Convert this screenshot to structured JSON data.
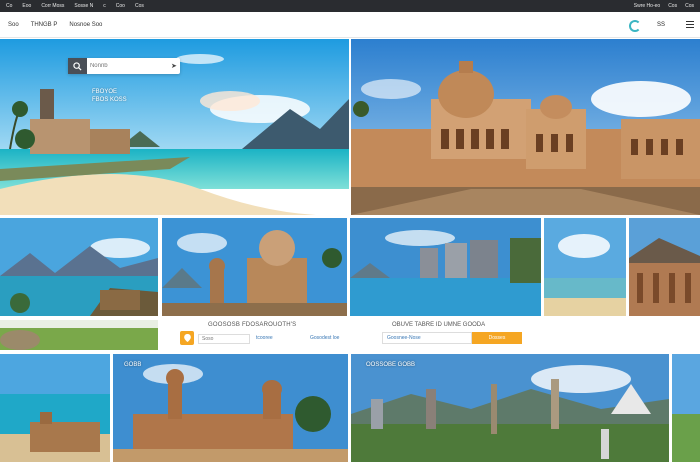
{
  "topbar": {
    "items": [
      "Co",
      "Eoo",
      "Corr Moss",
      "Sosse N",
      "c",
      "Coo",
      "Cos"
    ],
    "right": [
      "Swre Ho-eo",
      "Cos",
      "Cos"
    ]
  },
  "navbar": {
    "left_label": "Soo",
    "brand_text": "THNGB P",
    "search_label": "Nosnoe Soo",
    "right_label": "SS"
  },
  "hero": {
    "search_placeholder": "Nonnb",
    "caption_line1": "FBOYOE",
    "caption_line2": "FBOS KOSS"
  },
  "strip": {
    "title_left": "GOOSOSB FDOSAROUOTH'S",
    "title_right": "OBUVE TABRE ID UMNE GOODA",
    "field1": "Soso",
    "field2": "tcooree",
    "field3": "Gosodest loe",
    "field4": "Goosnee-Nose",
    "cta": "Dosses"
  },
  "bottom": {
    "label_left": "GOBB",
    "label_right": "OOSSOBE GOBB"
  },
  "colors": {
    "accent_orange": "#f5a623",
    "topbar_bg": "#2a2c30",
    "brand_teal": "#3ab5c2"
  },
  "icons": [
    "search-icon",
    "brand-logo-icon",
    "menu-icon",
    "arrow-icon",
    "location-icon"
  ]
}
